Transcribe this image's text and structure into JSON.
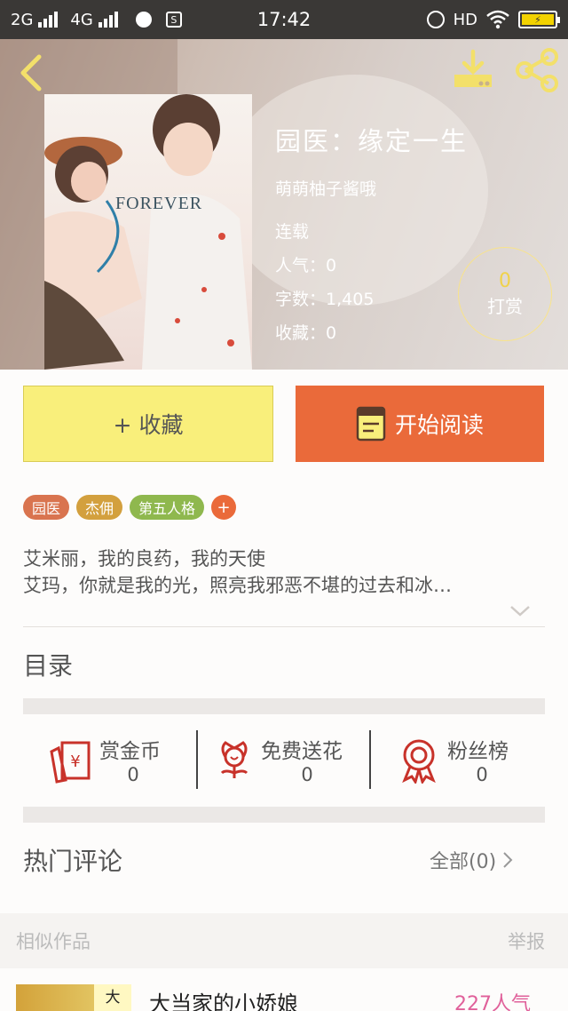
{
  "status_bar": {
    "net1": "2G",
    "net2": "4G",
    "time": "17:42",
    "hd": "HD",
    "battery_icon": "battery-charging-icon"
  },
  "book": {
    "title": "园医：缘定一生",
    "author": "萌萌柚子酱哦",
    "status": "连载",
    "popularity_label": "人气：",
    "popularity": "0",
    "words_label": "字数：",
    "words": "1,405",
    "favorites_label": "收藏：",
    "favorites": "0",
    "cover_text": "FOREVER"
  },
  "reward": {
    "count": "0",
    "label": "打赏"
  },
  "actions": {
    "collect": "+ 收藏",
    "read": "开始阅读"
  },
  "tags": [
    {
      "label": "园医",
      "color": "#d9744f"
    },
    {
      "label": "杰佣",
      "color": "#d3a03e"
    },
    {
      "label": "第五人格",
      "color": "#8fb84e"
    }
  ],
  "tag_add": "+",
  "synopsis": {
    "line1": "艾米丽，我的良药，我的天使",
    "line2": "艾玛，你就是我的光，照亮我邪恶不堪的过去和冰…"
  },
  "toc": {
    "title": "目录"
  },
  "stats": [
    {
      "label": "赏金币",
      "value": "0",
      "icon": "red-envelope-icon"
    },
    {
      "label": "免费送花",
      "value": "0",
      "icon": "flower-icon"
    },
    {
      "label": "粉丝榜",
      "value": "0",
      "icon": "medal-icon"
    }
  ],
  "comments": {
    "title": "热门评论",
    "all": "全部(0)"
  },
  "similar": {
    "title": "相似作品",
    "report": "举报",
    "items": [
      {
        "name": "大当家的小娇娘",
        "popularity": "227人气",
        "thumb_text": "大"
      }
    ]
  },
  "colors": {
    "accent_orange": "#ea6a3a",
    "collect_yellow": "#f9ef7b",
    "icon_yellow": "#f0d24a",
    "stat_red": "#c8322a",
    "popularity_pink": "#e0609a"
  }
}
